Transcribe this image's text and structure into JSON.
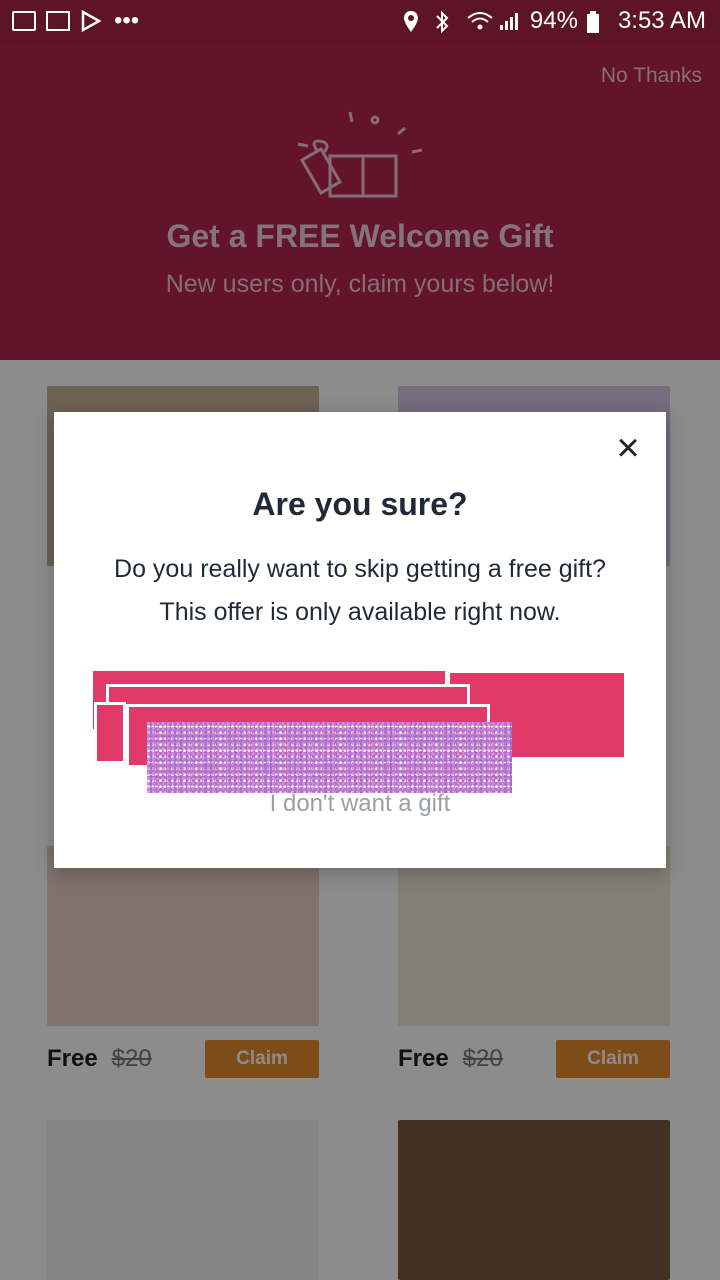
{
  "status_bar": {
    "battery": "94%",
    "time": "3:53 AM",
    "overflow": "•••"
  },
  "header": {
    "no_thanks": "No Thanks",
    "title": "Get a FREE Welcome Gift",
    "subtitle": "New users only, claim yours below!"
  },
  "products": [
    {
      "price": "Free",
      "old_price": "$20",
      "claim": "Claim"
    },
    {
      "price": "Free",
      "old_price": "$20",
      "claim": "Claim"
    }
  ],
  "modal": {
    "close": "×",
    "title": "Are you sure?",
    "body": "Do you really want to skip getting a free gift? This offer is only available right now.",
    "decline": "I don't want a gift"
  },
  "colors": {
    "header": "#b5244f",
    "accent_pink": "#df3a68",
    "claim_orange": "#e38a2d"
  }
}
